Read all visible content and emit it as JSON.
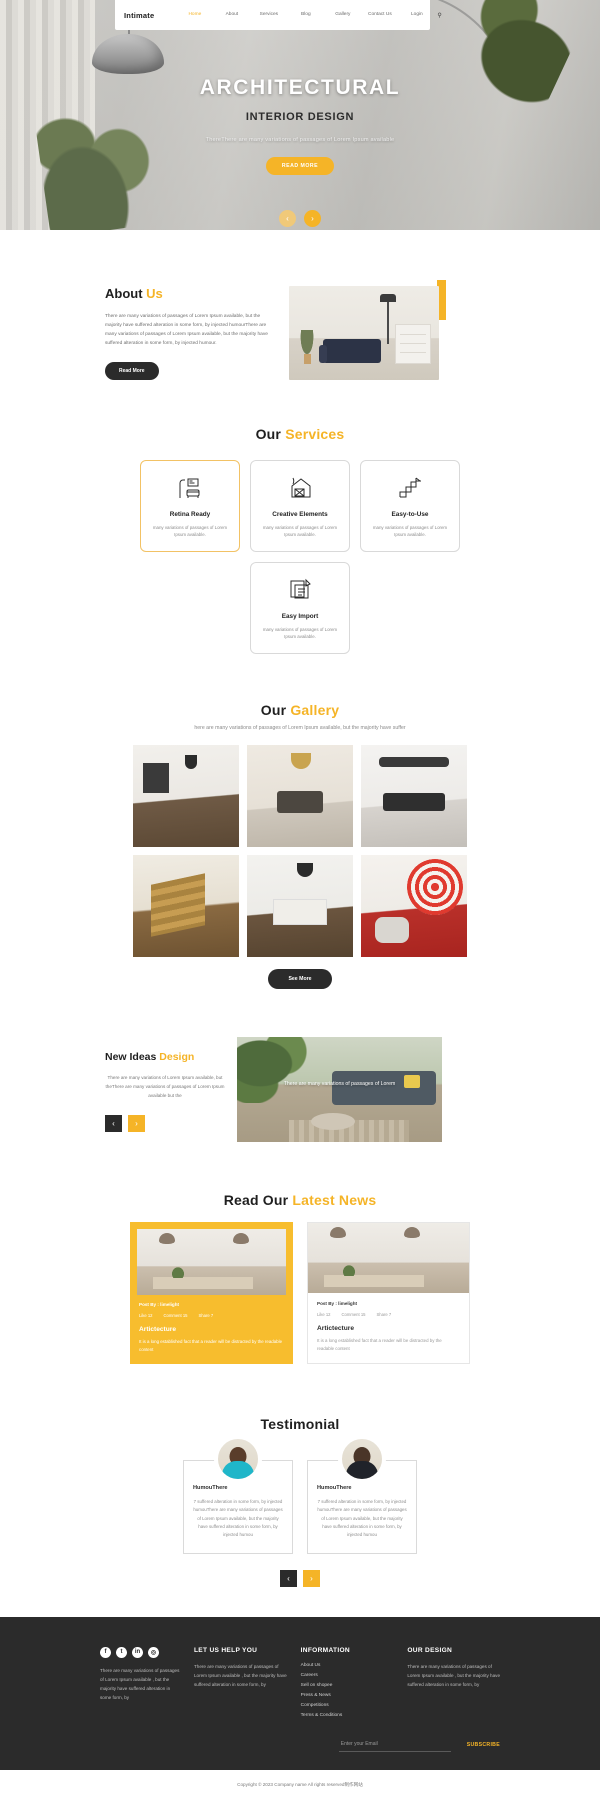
{
  "navbar": {
    "brand": "Intimate",
    "links": [
      {
        "label": "Home",
        "active": true
      },
      {
        "label": "About",
        "active": false
      },
      {
        "label": "Services",
        "active": false
      },
      {
        "label": "Blog",
        "active": false
      },
      {
        "label": "Gallery",
        "active": false
      },
      {
        "label": "Contact Us",
        "active": false
      },
      {
        "label": "Login",
        "active": false
      }
    ],
    "search_icon": "search-icon"
  },
  "hero": {
    "title": "ARCHITECTURAL",
    "subtitle": "INTERIOR DESIGN",
    "description": "ThereThere are many variations of passages of Lorem Ipsum available",
    "cta": "READ MORE",
    "prev_icon": "‹",
    "next_icon": "›"
  },
  "about": {
    "heading_main": "About",
    "heading_accent": "Us",
    "paragraph": "There are many variations of passages of Lorem Ipsum available, but the majority have suffered alteration in some form, by injected humourThere are many variations of passages of Lorem Ipsum available, but the majority have suffered alteration in some form, by injected humour.",
    "cta": "Read More"
  },
  "services": {
    "heading_main": "Our",
    "heading_accent": "Services",
    "cards": [
      {
        "title": "Retina Ready",
        "desc": "many variations of passages of Lorem Ipsum available.",
        "icon": "lamp-sofa-icon",
        "active": true
      },
      {
        "title": "Creative Elements",
        "desc": "many variations of passages of Lorem Ipsum available.",
        "icon": "house-paint-icon",
        "active": false
      },
      {
        "title": "Easy-to-Use",
        "desc": "many variations of passages of Lorem Ipsum available.",
        "icon": "stairs-icon",
        "active": false
      },
      {
        "title": "Easy Import",
        "desc": "many variations of passages of Lorem Ipsum available.",
        "icon": "swatch-icon",
        "active": false
      }
    ]
  },
  "gallery": {
    "heading_main": "Our",
    "heading_accent": "Gallery",
    "subtitle": "here are many variations of passages of Lorem Ipsum available, but the majority have suffer",
    "cta": "See More",
    "items": [
      {
        "alt": "modern-kitchen-dark-cabinets"
      },
      {
        "alt": "dining-room-chandelier"
      },
      {
        "alt": "dining-table-black-chairs"
      },
      {
        "alt": "wooden-staircase"
      },
      {
        "alt": "white-kitchen-island"
      },
      {
        "alt": "red-spiral-living-room"
      }
    ]
  },
  "ideas": {
    "heading_main": "New Ideas",
    "heading_accent": "Design",
    "paragraph": "There are many variations of Lorem Ipsum available, but theThere are many variations of passages of Lorem Ipsum available but the",
    "overlay_text": "There are many variations of passages of Lorem",
    "prev_icon": "‹",
    "next_icon": "›"
  },
  "news": {
    "heading_main": "Read Our",
    "heading_accent": "Latest News",
    "cards": [
      {
        "author": "Post By : limelight",
        "meta": [
          {
            "label": "Like 12"
          },
          {
            "label": "Comment 15"
          },
          {
            "label": "Share 7"
          }
        ],
        "title": "Artictecture",
        "excerpt": "It is a long established fact that a reader will be distracted by the readable content",
        "featured": true
      },
      {
        "author": "Post By : limelight",
        "meta": [
          {
            "label": "Like 12"
          },
          {
            "label": "Comment 15"
          },
          {
            "label": "Share 7"
          }
        ],
        "title": "Artictecture",
        "excerpt": "It is a long established fact that a reader will be distracted by the readable content",
        "featured": false
      }
    ]
  },
  "testimonial": {
    "heading": "Testimonial",
    "cards": [
      {
        "name": "HumouThere",
        "quote": "7 suffered alteration in some form, by injected humouThere are many variations of passages of Lorem Ipsum available, but the majority have suffered alteration in some form, by injected humou"
      },
      {
        "name": "HumouThere",
        "quote": "7 suffered alteration in some form, by injected humouThere are many variations of passages of Lorem Ipsum available, but the majority have suffered alteration in some form, by injected humou"
      }
    ],
    "prev_icon": "‹",
    "next_icon": "›"
  },
  "footer": {
    "social": [
      {
        "name": "facebook-icon",
        "glyph": "f"
      },
      {
        "name": "twitter-icon",
        "glyph": "t"
      },
      {
        "name": "linkedin-icon",
        "glyph": "in"
      },
      {
        "name": "instagram-icon",
        "glyph": "◎"
      }
    ],
    "social_text": "There are many variations of passages of Lorem Ipsum available , but the majority have suffered alteration in some form, by",
    "columns": [
      {
        "heading": "LET US HELP YOU",
        "text": "There are many variations of passages of Lorem Ipsum available , but the majority have suffered alteration in some form, by",
        "links": []
      },
      {
        "heading": "INFORMATION",
        "text": "",
        "links": [
          "About Us",
          "Careers",
          "Sell on shopee",
          "Press & News",
          "Competitions",
          "Terms & Conditions"
        ]
      },
      {
        "heading": "OUR DESIGN",
        "text": "There are many variations of passages of Lorem Ipsum available , but the majority have suffered alteration in some form, by",
        "links": []
      }
    ],
    "newsletter": {
      "placeholder": "Enter your Email",
      "value": "",
      "button": "SUBSCRIBE"
    },
    "copyright": "Copyright © 2023 Company name All rights reserved制作网站"
  }
}
